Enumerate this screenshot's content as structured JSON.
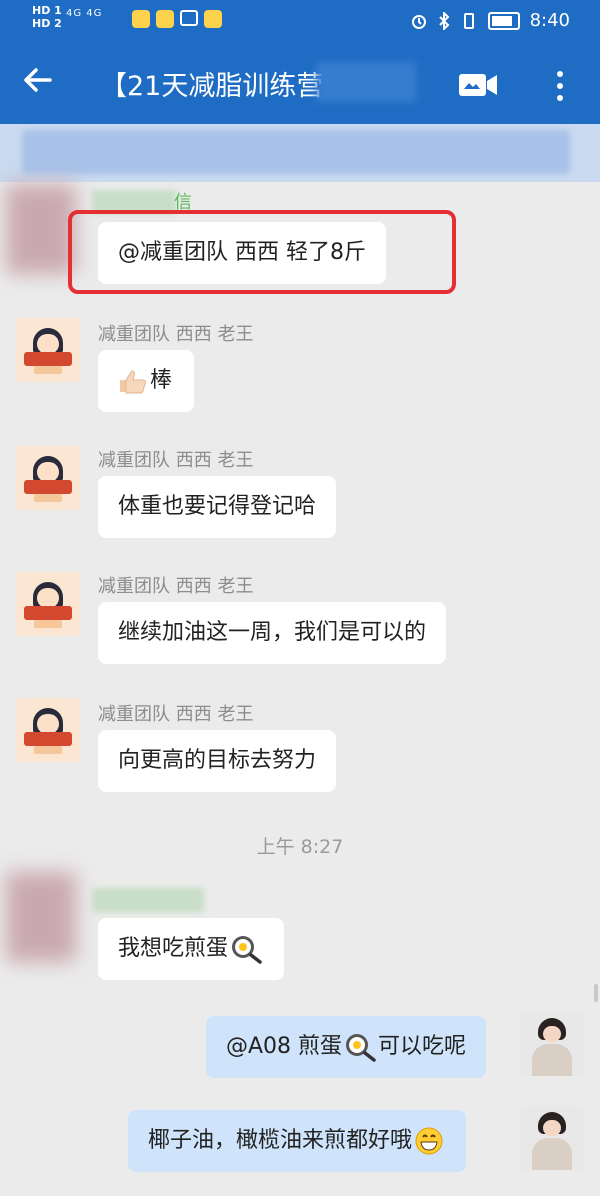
{
  "status_bar": {
    "hd1": "HD 1",
    "hd2": "HD 2",
    "net": "4G 4G",
    "time": "8:40"
  },
  "header": {
    "title": "【21天减脂训练营"
  },
  "messages": [
    {
      "sender": "信",
      "text": "@减重团队 西西 轻了8斤"
    },
    {
      "sender": "减重团队 西西 老王",
      "text": "棒"
    },
    {
      "sender": "减重团队 西西 老王",
      "text": "体重也要记得登记哈"
    },
    {
      "sender": "减重团队 西西 老王",
      "text": "继续加油这一周，我们是可以的"
    },
    {
      "sender": "减重团队 西西 老王",
      "text": "向更高的目标去努力"
    },
    {
      "text": "我想吃煎蛋"
    },
    {
      "text_a": "@A08 煎蛋",
      "text_b": "可以吃呢"
    },
    {
      "text": "椰子油，橄榄油来煎都好哦"
    }
  ],
  "timestamp": "上午 8:27",
  "colors": {
    "header": "#1f6cc4",
    "highlight": "#e53033",
    "mine_bubble": "#cfe4fb"
  }
}
